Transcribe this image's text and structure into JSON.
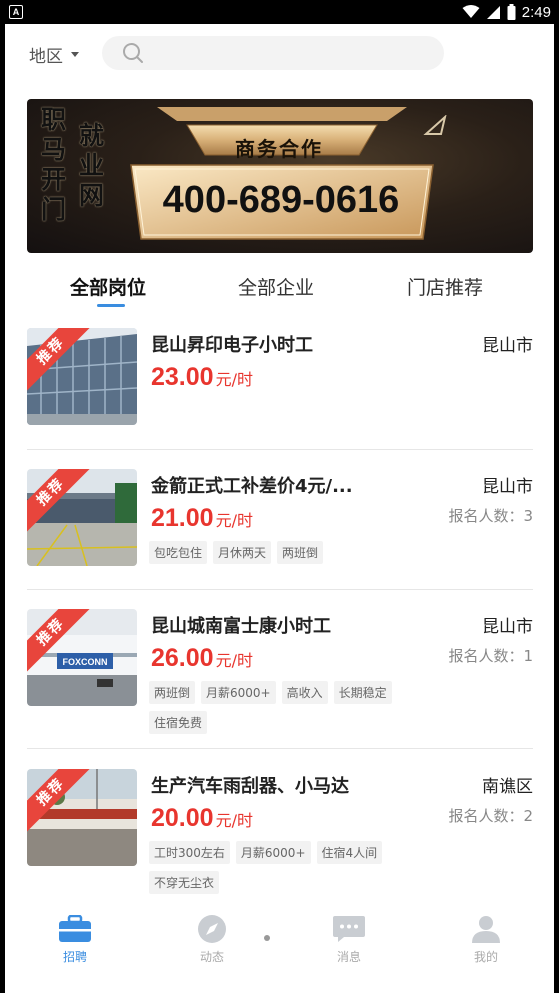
{
  "status_bar": {
    "time": "2:49",
    "app_badge": "A"
  },
  "header": {
    "region_label": "地区",
    "search_placeholder": ""
  },
  "banner": {
    "vertical_text_col1": [
      "职",
      "马",
      "开",
      "门"
    ],
    "vertical_text_col2": [
      "就",
      "业",
      "网"
    ],
    "title": "商务合作",
    "phone": "400-689-0616"
  },
  "tabs": [
    {
      "label": "全部岗位",
      "active": true
    },
    {
      "label": "全部企业",
      "active": false
    },
    {
      "label": "门店推荐",
      "active": false
    }
  ],
  "jobs": [
    {
      "badge": "推荐",
      "title": "昆山昇印电子小时工",
      "city": "昆山市",
      "pay": "23.00",
      "unit": "元/时",
      "count_label": "",
      "tags": []
    },
    {
      "badge": "推荐",
      "title": "金箭正式工补差价4元/...",
      "city": "昆山市",
      "pay": "21.00",
      "unit": "元/时",
      "count_label": "报名人数：3",
      "tags": [
        "包吃包住",
        "月休两天",
        "两班倒"
      ]
    },
    {
      "badge": "推荐",
      "title": "昆山城南富士康小时工",
      "city": "昆山市",
      "pay": "26.00",
      "unit": "元/时",
      "count_label": "报名人数：1",
      "tags": [
        "两班倒",
        "月薪6000+",
        "高收入",
        "长期稳定",
        "住宿免费"
      ]
    },
    {
      "badge": "推荐",
      "title": "生产汽车雨刮器、小马达",
      "city": "南谯区",
      "pay": "20.00",
      "unit": "元/时",
      "count_label": "报名人数：2",
      "tags": [
        "工时300左右",
        "月薪6000+",
        "住宿4人间",
        "不穿无尘衣"
      ]
    }
  ],
  "photo_text": {
    "foxconn": "FOXCONN"
  },
  "bottom_nav": [
    {
      "label": "招聘",
      "icon": "briefcase-icon",
      "active": true
    },
    {
      "label": "动态",
      "icon": "compass-icon",
      "active": false
    },
    {
      "label": "消息",
      "icon": "chat-icon",
      "active": false
    },
    {
      "label": "我的",
      "icon": "user-icon",
      "active": false
    }
  ],
  "colors": {
    "accent": "#3a8de0",
    "price": "#e8352e",
    "badge": "#e8453c"
  }
}
